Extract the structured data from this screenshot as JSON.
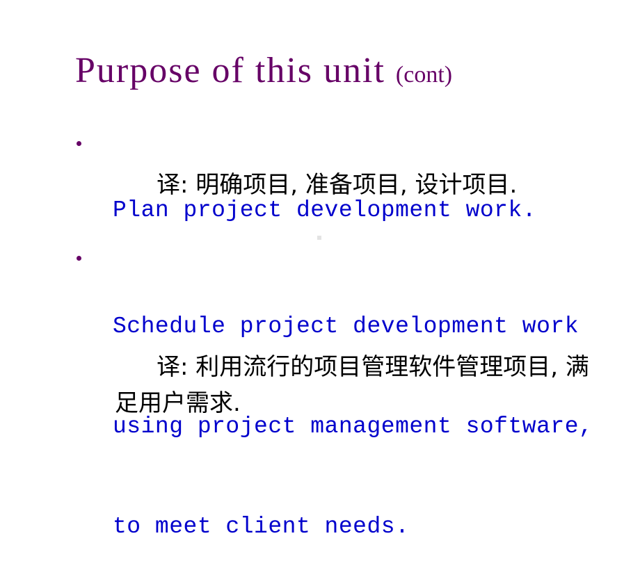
{
  "slide": {
    "title": "Purpose of this unit",
    "title_suffix": "(cont)",
    "bullets": [
      {
        "text_lines": [
          "Plan project development work."
        ],
        "translation": "译: 明确项目, 准备项目, 设计项目."
      },
      {
        "text_lines": [
          "Schedule project development work",
          "using project management software,",
          "to meet client needs."
        ],
        "translation": "译: 利用流行的项目管理软件管理项目, 满足用户需求."
      }
    ],
    "colors": {
      "title": "#660066",
      "bullet_text": "#0000cc",
      "translation": "#000000"
    }
  }
}
